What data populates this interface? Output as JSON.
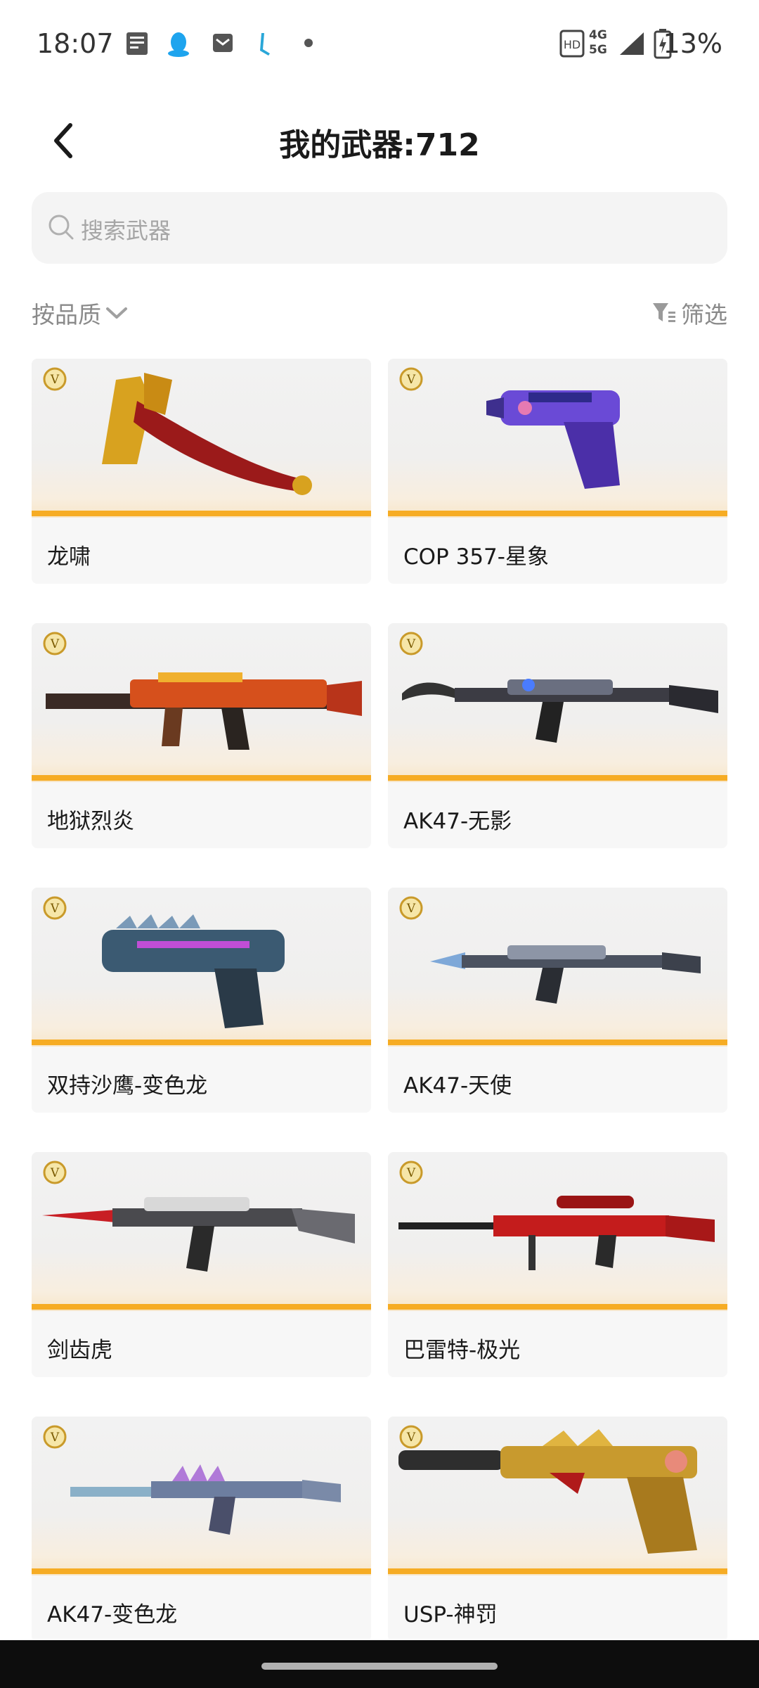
{
  "status_bar": {
    "time": "18:07",
    "network_top": "4G",
    "network_bottom": "5G",
    "battery": "13%"
  },
  "header": {
    "title": "我的武器:712"
  },
  "search": {
    "placeholder": "搜索武器"
  },
  "toolbar": {
    "sort_label": "按品质",
    "filter_label": "筛选"
  },
  "colors": {
    "accent_bar": "#f6ac24",
    "badge": "#c99a2a"
  },
  "badge_letter": "V",
  "weapons": [
    {
      "name": "龙啸",
      "icon": "dragon-axe-icon"
    },
    {
      "name": "COP 357-星象",
      "icon": "pistol-icon"
    },
    {
      "name": "地狱烈炎",
      "icon": "rifle-icon"
    },
    {
      "name": "AK47-无影",
      "icon": "rifle-icon"
    },
    {
      "name": "双持沙鹰-变色龙",
      "icon": "pistol-icon"
    },
    {
      "name": "AK47-天使",
      "icon": "rifle-icon"
    },
    {
      "name": "剑齿虎",
      "icon": "rifle-icon"
    },
    {
      "name": "巴雷特-极光",
      "icon": "sniper-icon"
    },
    {
      "name": "AK47-变色龙",
      "icon": "rifle-icon"
    },
    {
      "name": "USP-神罚",
      "icon": "pistol-icon"
    }
  ]
}
